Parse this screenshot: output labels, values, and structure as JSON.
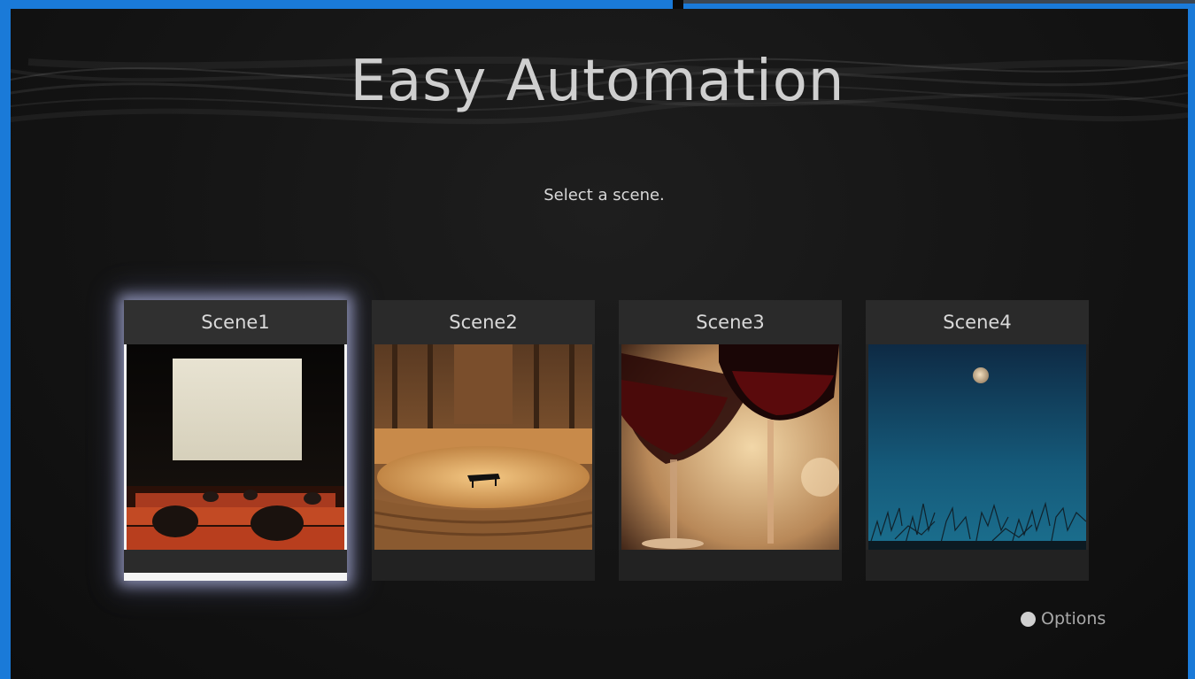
{
  "app": {
    "title": "Easy Automation",
    "prompt": "Select a scene."
  },
  "scenes": [
    {
      "label": "Scene1",
      "image": "movie-theater-photo",
      "selected": true
    },
    {
      "label": "Scene2",
      "image": "concert-hall-piano-photo",
      "selected": false
    },
    {
      "label": "Scene3",
      "image": "wine-glasses-photo",
      "selected": false
    },
    {
      "label": "Scene4",
      "image": "moon-night-sky-photo",
      "selected": false
    }
  ],
  "footer": {
    "options_label": "Options",
    "options_icon": "circle-button-icon"
  },
  "colors": {
    "frame": "#1a7ad8",
    "background": "#141414",
    "selection_glow": "#c8cdff"
  }
}
